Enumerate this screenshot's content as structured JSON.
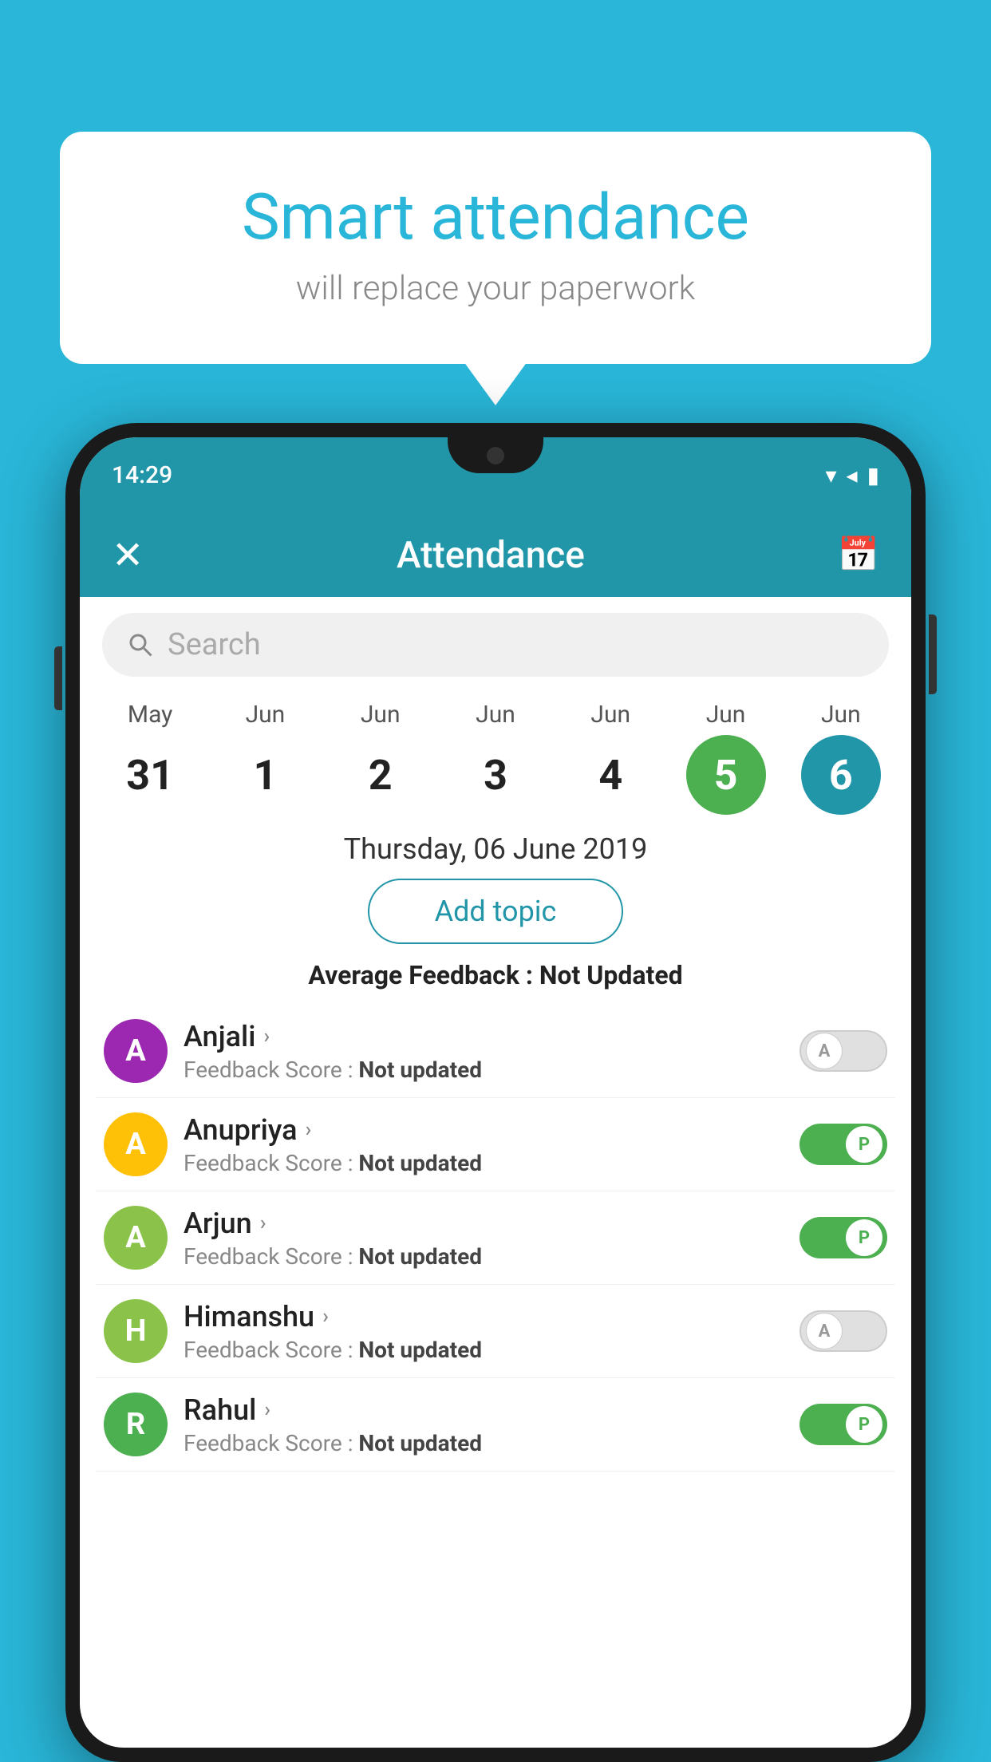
{
  "background": {
    "color": "#29b6d8"
  },
  "speech_bubble": {
    "title": "Smart attendance",
    "subtitle": "will replace your paperwork"
  },
  "status_bar": {
    "time": "14:29",
    "icons": "▼◄▮"
  },
  "app_header": {
    "title": "Attendance",
    "close_label": "✕",
    "calendar_icon": "📅"
  },
  "search": {
    "placeholder": "Search"
  },
  "calendar": {
    "days": [
      {
        "month": "May",
        "date": "31",
        "state": "normal"
      },
      {
        "month": "Jun",
        "date": "1",
        "state": "normal"
      },
      {
        "month": "Jun",
        "date": "2",
        "state": "normal"
      },
      {
        "month": "Jun",
        "date": "3",
        "state": "normal"
      },
      {
        "month": "Jun",
        "date": "4",
        "state": "normal"
      },
      {
        "month": "Jun",
        "date": "5",
        "state": "today"
      },
      {
        "month": "Jun",
        "date": "6",
        "state": "selected"
      }
    ]
  },
  "selected_date_label": "Thursday, 06 June 2019",
  "add_topic_button": "Add topic",
  "avg_feedback": {
    "label": "Average Feedback : ",
    "value": "Not Updated"
  },
  "students": [
    {
      "name": "Anjali",
      "avatar_letter": "A",
      "avatar_color": "#9c27b0",
      "feedback": "Not updated",
      "attendance": "absent"
    },
    {
      "name": "Anupriya",
      "avatar_letter": "A",
      "avatar_color": "#ffc107",
      "feedback": "Not updated",
      "attendance": "present"
    },
    {
      "name": "Arjun",
      "avatar_letter": "A",
      "avatar_color": "#8bc34a",
      "feedback": "Not updated",
      "attendance": "present"
    },
    {
      "name": "Himanshu",
      "avatar_letter": "H",
      "avatar_color": "#8bc34a",
      "feedback": "Not updated",
      "attendance": "absent"
    },
    {
      "name": "Rahul",
      "avatar_letter": "R",
      "avatar_color": "#4caf50",
      "feedback": "Not updated",
      "attendance": "present"
    }
  ]
}
